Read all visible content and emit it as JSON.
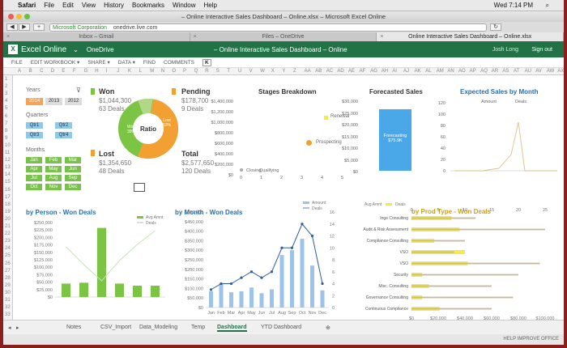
{
  "mac_menu": {
    "app": "Safari",
    "items": [
      "File",
      "Edit",
      "View",
      "History",
      "Bookmarks",
      "Window",
      "Help"
    ],
    "clock": "Wed 7:14 PM"
  },
  "window": {
    "title": "– Online Interactive Sales Dashboard – Online.xlsx – Microsoft Excel Online"
  },
  "browser": {
    "site_label": "Microsoft Corporation",
    "url": "onedrive.live.com",
    "tabs": [
      {
        "label": "Inbox – Gmail",
        "active": false
      },
      {
        "label": "Files – OneDrive",
        "active": false
      },
      {
        "label": "Online Interactive Sales Dashboard – Online.xlsx",
        "active": true
      }
    ]
  },
  "excel_header": {
    "app": "Excel Online",
    "service": "OneDrive",
    "document": "– Online Interactive Sales Dashboard – Online",
    "user": "Josh Long",
    "sign_out": "Sign out"
  },
  "ribbon": {
    "items": [
      "FILE",
      "EDIT WORKBOOK ▾",
      "SHARE ▾",
      "DATA ▾",
      "FIND",
      "COMMENTS"
    ],
    "active_col": "K"
  },
  "columns": [
    "A",
    "B",
    "C",
    "D",
    "E",
    "F",
    "G",
    "H",
    "I",
    "J",
    "K",
    "L",
    "M",
    "N",
    "O",
    "P",
    "Q",
    "R",
    "S",
    "T",
    "U",
    "V",
    "W",
    "X",
    "Y",
    "Z",
    "AA",
    "AB",
    "AC",
    "AD",
    "AE",
    "AF",
    "AG",
    "AH",
    "AI",
    "AJ",
    "AK",
    "AL",
    "AM",
    "AN",
    "AO",
    "AP",
    "AQ",
    "AR",
    "AS",
    "AT",
    "AU",
    "AV",
    "AW",
    "AX"
  ],
  "rows": [
    "1",
    "2",
    "3",
    "4",
    "5",
    "6",
    "7",
    "8",
    "9",
    "10",
    "11",
    "12",
    "13",
    "14",
    "15",
    "16",
    "17",
    "18",
    "19",
    "20",
    "21",
    "22",
    "23",
    "24",
    "25",
    "26",
    "27",
    "28",
    "29",
    "30",
    "31",
    "32",
    "33"
  ],
  "slicers": {
    "years_label": "Years",
    "years": [
      "2014",
      "2013",
      "2012"
    ],
    "quarters_label": "Quarters",
    "quarters": [
      "Qtr1",
      "Qtr2",
      "Qtr3",
      "Qtr4"
    ],
    "months_label": "Months",
    "months": [
      "Jan",
      "Feb",
      "Mar",
      "Apr",
      "May",
      "Jun",
      "Jul",
      "Aug",
      "Sep",
      "Oct",
      "Nov",
      "Dec"
    ]
  },
  "kpis": {
    "won": {
      "label": "Won",
      "value": "$1,044,300",
      "deals": "63 Deals"
    },
    "lost": {
      "label": "Lost",
      "value": "$1,354,650",
      "deals": "48 Deals"
    },
    "pending": {
      "label": "Pending",
      "value": "$178,700",
      "deals": "9 Deals"
    },
    "total": {
      "label": "Total",
      "value": "$2,577,650",
      "deals": "120 Deals"
    }
  },
  "ratio": {
    "center": "Ratio",
    "won_label": "Won",
    "won_pct": "39%",
    "lost_label": "Lost",
    "lost_pct": "53%",
    "won_color": "#7cc443",
    "lost_color": "#f2a031",
    "pending_color": "#b1d886"
  },
  "stages": {
    "title": "Stages Breakdown",
    "y_ticks": [
      "$1,400,000",
      "$1,200,000",
      "$1,000,000",
      "$800,000",
      "$600,000",
      "$400,000",
      "$200,000",
      "$0"
    ],
    "legend": [
      "Renewal",
      "Prospecting"
    ],
    "x_label": "Closing",
    "qualifying": "Qualifying",
    "x_ticks": [
      "0",
      "1",
      "2",
      "3",
      "4",
      "5"
    ]
  },
  "forecast": {
    "title": "Forecasted Sales",
    "y_ticks": [
      "$30,000",
      "$25,000",
      "$20,000",
      "$15,000",
      "$10,000",
      "$5,000",
      "$0"
    ],
    "bar_label": "Forecasting",
    "bar_value": "$75.9K"
  },
  "expected": {
    "title": "Expected Sales by Month",
    "legend": [
      "Amount",
      "Deals"
    ],
    "y_ticks": [
      "120",
      "100",
      "80",
      "60",
      "40",
      "20",
      "0"
    ]
  },
  "chart_data": [
    {
      "type": "bar",
      "title": "by Person - Won Deals",
      "legend": [
        "Avg Amnt",
        "Deals"
      ],
      "y_ticks": [
        "$250,000",
        "$225,000",
        "$200,000",
        "$175,000",
        "$150,000",
        "$125,000",
        "$100,000",
        "$75,000",
        "$50,000",
        "$25,000",
        "$0"
      ],
      "values": [
        45000,
        48000,
        232000,
        45000,
        38000,
        38000
      ]
    },
    {
      "type": "bar",
      "title": "by Month - Won Deals",
      "legend": [
        "Amount",
        "Deals"
      ],
      "categories": [
        "Jan",
        "Feb",
        "Mar",
        "Apr",
        "May",
        "Jun",
        "Jul",
        "Aug",
        "Sep",
        "Oct",
        "Nov",
        "Dec"
      ],
      "y_ticks": [
        "$500,000",
        "$450,000",
        "$400,000",
        "$350,000",
        "$300,000",
        "$250,000",
        "$200,000",
        "$150,000",
        "$100,000",
        "$50,000",
        "$0"
      ],
      "y2_ticks": [
        "16",
        "14",
        "12",
        "10",
        "8",
        "6",
        "4",
        "2",
        "0"
      ],
      "values": [
        85000,
        125000,
        80000,
        85000,
        105000,
        75000,
        95000,
        275000,
        300000,
        360000,
        220000,
        90000
      ],
      "deals": [
        3,
        4,
        4,
        5,
        6,
        5,
        6,
        10,
        10,
        14,
        12,
        4
      ]
    },
    {
      "type": "bar",
      "title": "by Prod Type - Won Deals",
      "legend": [
        "Avg Amnt",
        "Deals"
      ],
      "categories": [
        "Inge Consulting",
        "Audit &amp; Risk Assessment",
        "Compliance Consulting",
        "VSO",
        "VSO",
        "Security",
        "Misc. Consulting",
        "Governance Consulting",
        "Continuous Compliance"
      ],
      "x_ticks": [
        "$0",
        "$20,000",
        "$40,000",
        "$60,000",
        "$80,000",
        "$100,000"
      ],
      "x2_ticks": [
        "0",
        "5",
        "10",
        "15",
        "20",
        "25"
      ],
      "values": [
        30000,
        36000,
        17000,
        40000,
        42000,
        8000,
        13000,
        8000,
        21000
      ],
      "deals": [
        12,
        25,
        10,
        8,
        24,
        20,
        15,
        19,
        15
      ]
    }
  ],
  "sheet_tabs": [
    "Notes",
    "CSV_Import",
    "Data_Modeling",
    "Temp",
    "Dashboard",
    "YTD Dashboard"
  ],
  "active_sheet": "Dashboard",
  "status": "HELP IMPROVE OFFICE"
}
